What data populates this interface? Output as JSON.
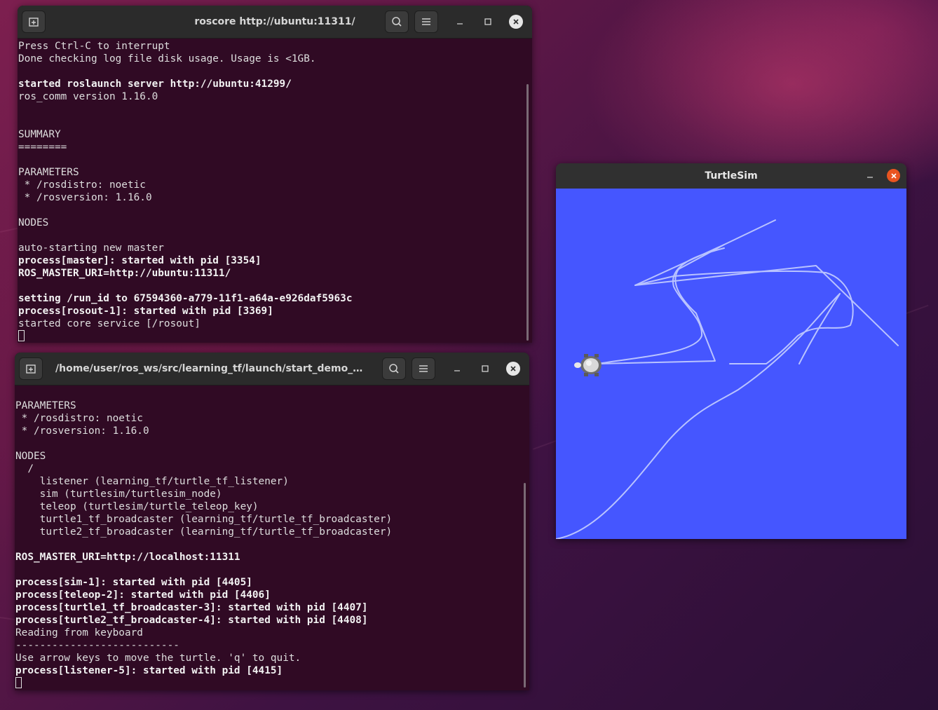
{
  "terminal_top": {
    "title": "roscore http://ubuntu:11311/",
    "lines": [
      {
        "text": "Press Ctrl-C to interrupt",
        "bold": false
      },
      {
        "text": "Done checking log file disk usage. Usage is <1GB.",
        "bold": false
      },
      {
        "text": "",
        "bold": false
      },
      {
        "text": "started roslaunch server http://ubuntu:41299/",
        "bold": true
      },
      {
        "text": "ros_comm version 1.16.0",
        "bold": false
      },
      {
        "text": "",
        "bold": false
      },
      {
        "text": "",
        "bold": false
      },
      {
        "text": "SUMMARY",
        "bold": false
      },
      {
        "text": "========",
        "bold": false
      },
      {
        "text": "",
        "bold": false
      },
      {
        "text": "PARAMETERS",
        "bold": false
      },
      {
        "text": " * /rosdistro: noetic",
        "bold": false
      },
      {
        "text": " * /rosversion: 1.16.0",
        "bold": false
      },
      {
        "text": "",
        "bold": false
      },
      {
        "text": "NODES",
        "bold": false
      },
      {
        "text": "",
        "bold": false
      },
      {
        "text": "auto-starting new master",
        "bold": false
      },
      {
        "text": "process[master]: started with pid [3354]",
        "bold": true
      },
      {
        "text": "ROS_MASTER_URI=http://ubuntu:11311/",
        "bold": true
      },
      {
        "text": "",
        "bold": false
      },
      {
        "text": "setting /run_id to 67594360-a779-11f1-a64a-e926daf5963c",
        "bold": true
      },
      {
        "text": "process[rosout-1]: started with pid [3369]",
        "bold": true
      },
      {
        "text": "started core service [/rosout]",
        "bold": false
      }
    ]
  },
  "terminal_bottom": {
    "title": "/home/user/ros_ws/src/learning_tf/launch/start_demo_with...",
    "lines": [
      {
        "text": "PARAMETERS",
        "bold": false
      },
      {
        "text": " * /rosdistro: noetic",
        "bold": false
      },
      {
        "text": " * /rosversion: 1.16.0",
        "bold": false
      },
      {
        "text": "",
        "bold": false
      },
      {
        "text": "NODES",
        "bold": false
      },
      {
        "text": "  /",
        "bold": false
      },
      {
        "text": "    listener (learning_tf/turtle_tf_listener)",
        "bold": false
      },
      {
        "text": "    sim (turtlesim/turtlesim_node)",
        "bold": false
      },
      {
        "text": "    teleop (turtlesim/turtle_teleop_key)",
        "bold": false
      },
      {
        "text": "    turtle1_tf_broadcaster (learning_tf/turtle_tf_broadcaster)",
        "bold": false
      },
      {
        "text": "    turtle2_tf_broadcaster (learning_tf/turtle_tf_broadcaster)",
        "bold": false
      },
      {
        "text": "",
        "bold": false
      },
      {
        "text": "ROS_MASTER_URI=http://localhost:11311",
        "bold": true
      },
      {
        "text": "",
        "bold": false
      },
      {
        "text": "process[sim-1]: started with pid [4405]",
        "bold": true
      },
      {
        "text": "process[teleop-2]: started with pid [4406]",
        "bold": true
      },
      {
        "text": "process[turtle1_tf_broadcaster-3]: started with pid [4407]",
        "bold": true
      },
      {
        "text": "process[turtle2_tf_broadcaster-4]: started with pid [4408]",
        "bold": true
      },
      {
        "text": "Reading from keyboard",
        "bold": false
      },
      {
        "text": "---------------------------",
        "bold": false
      },
      {
        "text": "Use arrow keys to move the turtle. 'q' to quit.",
        "bold": false
      },
      {
        "text": "process[listener-5]: started with pid [4415]",
        "bold": true
      }
    ]
  },
  "turtlesim": {
    "title": "TurtleSim",
    "background_color": "#4556ff",
    "trail_color": "#b9c3ff"
  },
  "colors": {
    "terminal_bg": "#300a24",
    "close_accent": "#e95420"
  },
  "icons": {
    "new_tab": "new-tab-icon",
    "search": "search-icon",
    "menu": "hamburger-menu-icon",
    "minimize": "minimize-icon",
    "maximize": "maximize-icon",
    "close": "close-icon"
  }
}
